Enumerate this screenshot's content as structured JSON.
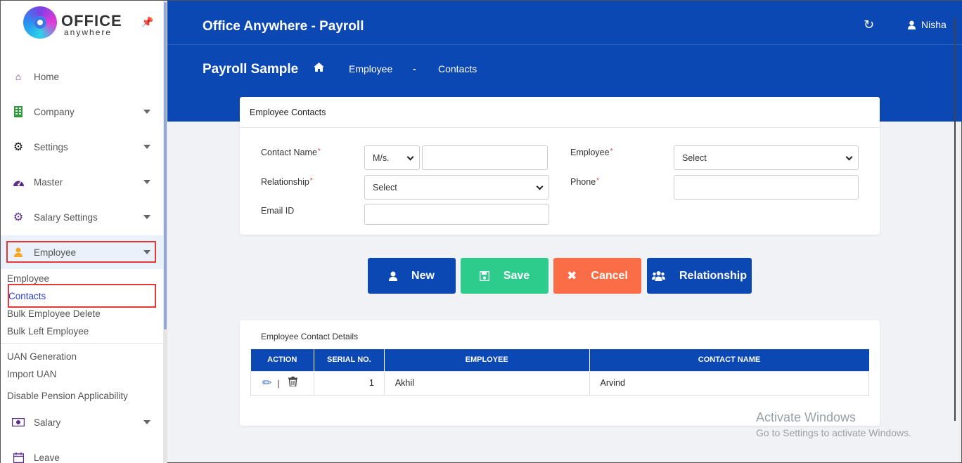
{
  "logo": {
    "title": "OFFICE",
    "subtitle": "anywhere"
  },
  "sidebar": {
    "items": [
      {
        "label": "Home",
        "icon": "home-icon"
      },
      {
        "label": "Company",
        "icon": "building-icon"
      },
      {
        "label": "Settings",
        "icon": "gear-icon"
      },
      {
        "label": "Master",
        "icon": "dashboard-icon"
      },
      {
        "label": "Salary Settings",
        "icon": "cog-icon"
      },
      {
        "label": "Employee",
        "icon": "user-icon"
      }
    ],
    "employee_sub": [
      "Employee",
      "Contacts",
      "Bulk Employee Delete",
      "Bulk Left Employee"
    ],
    "other_sub": [
      "UAN Generation",
      "Import UAN",
      "Disable Pension Applicability"
    ],
    "bottom_items": [
      {
        "label": "Salary",
        "icon": "money-icon"
      },
      {
        "label": "Leave",
        "icon": "calendar-icon"
      }
    ]
  },
  "header": {
    "app_title": "Office Anywhere - Payroll",
    "user_name": "Nisha",
    "page_title": "Payroll Sample",
    "breadcrumb": [
      "Employee",
      "-",
      "Contacts"
    ]
  },
  "form": {
    "title": "Employee Contacts",
    "contact_name_label": "Contact Name",
    "salutation_value": "M/s.",
    "contact_name_value": "",
    "employee_label": "Employee",
    "employee_value": "Select",
    "relationship_label": "Relationship",
    "relationship_value": "Select",
    "phone_label": "Phone",
    "phone_value": "",
    "email_label": "Email ID",
    "email_value": "",
    "required_mark": "*"
  },
  "buttons": {
    "new": "New",
    "save": "Save",
    "cancel": "Cancel",
    "relationship": "Relationship"
  },
  "colors": {
    "primary": "#0b48b3",
    "new": "#0b48b3",
    "save": "#2ecc8c",
    "cancel": "#fa6d46",
    "relationship": "#0b48b3"
  },
  "table": {
    "title": "Employee Contact Details",
    "headers": [
      "ACTION",
      "SERIAL NO.",
      "EMPLOYEE",
      "CONTACT NAME"
    ],
    "rows": [
      {
        "serial": "1",
        "employee": "Akhil",
        "contact_name": "Arvind"
      }
    ]
  },
  "watermark": {
    "line1": "Activate Windows",
    "line2": "Go to Settings to activate Windows."
  }
}
